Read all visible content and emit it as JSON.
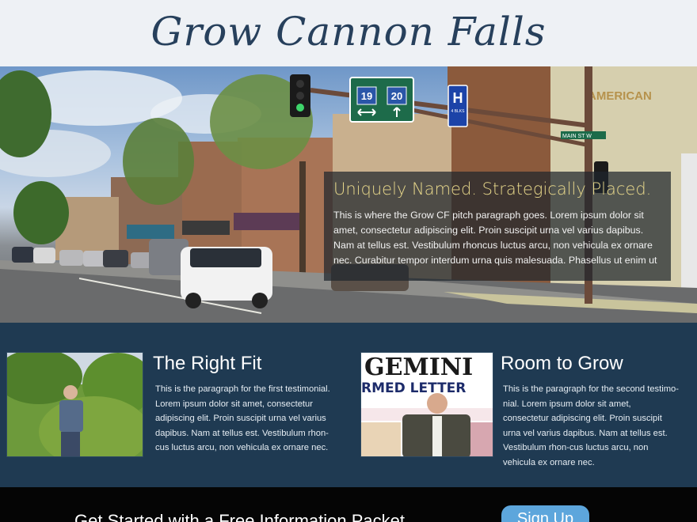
{
  "header": {
    "logo_text": "Grow Cannon Falls"
  },
  "hero": {
    "signs": {
      "route_1": "19",
      "route_2": "20",
      "hospital": "H",
      "hospital_note": "4 BLKS",
      "street_sign": "MAIN ST W",
      "store_sign": "AMERICAN"
    },
    "pitch": {
      "title": "Uniquely Named. Strategically Placed.",
      "body": "This is where the Grow CF pitch paragraph goes. Lorem ipsum dolor sit amet, consectetur adipiscing elit. Proin suscipit urna vel varius dapibus. Nam at tellus est. Vestibulum rhoncus luctus arcu, non vehicula ex ornare nec. Curabitur tempor interdum urna quis malesuada. Phasellus ut enim ut"
    }
  },
  "testimonials": [
    {
      "title": "The Right Fit",
      "body": "This is the paragraph for the first testimonial. Lorem ipsum dolor sit amet, consectetur adipiscing elit. Proin suscipit urna vel varius dapibus. Nam at tellus est. Vestibulum rhon-cus luctus arcu, non vehicula ex ornare nec."
    },
    {
      "title": "Room to Grow",
      "body": "This is the paragraph for the second testimo-nial. Lorem ipsum dolor sit amet, consectetur adipiscing elit. Proin suscipit urna vel varius dapibus. Nam at tellus est. Vestibulum rhon-cus luctus arcu, non vehicula ex ornare nec.",
      "photo_sign_line1": "GEMINI",
      "photo_sign_line2": "RMED LETTER"
    }
  ],
  "cta": {
    "text": "Get Started with a Free Information Packet",
    "button_label": "Sign Up"
  },
  "colors": {
    "header_bg": "#eef1f5",
    "logo": "#27405c",
    "section_bg": "#1f3a52",
    "pitch_title": "#e8d88b",
    "cta_bg": "#050505",
    "button": "#5da6dc",
    "sign_green": "#1d6b4a"
  }
}
